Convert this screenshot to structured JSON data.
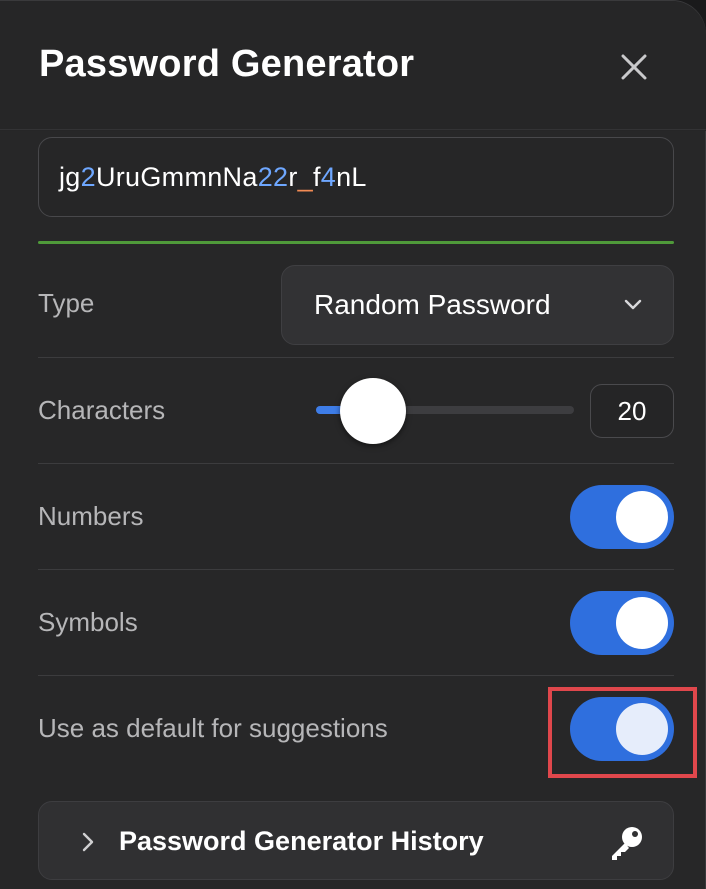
{
  "header": {
    "title": "Password Generator",
    "close_icon": "close-icon"
  },
  "password": {
    "segments": [
      {
        "text": "jg",
        "kind": "letter"
      },
      {
        "text": "2",
        "kind": "digit"
      },
      {
        "text": "UruGmmnNa",
        "kind": "letter"
      },
      {
        "text": "22",
        "kind": "digit"
      },
      {
        "text": "r",
        "kind": "letter"
      },
      {
        "text": "_",
        "kind": "symbol"
      },
      {
        "text": "f",
        "kind": "letter"
      },
      {
        "text": "4",
        "kind": "digit"
      },
      {
        "text": "nL",
        "kind": "letter"
      }
    ],
    "strength_color": "#4f9a3a"
  },
  "type_row": {
    "label": "Type",
    "selected": "Random Password",
    "icon": "chevron-down-icon"
  },
  "characters_row": {
    "label": "Characters",
    "value": "20",
    "slider_fraction": 0.2
  },
  "numbers_row": {
    "label": "Numbers",
    "enabled": true
  },
  "symbols_row": {
    "label": "Symbols",
    "enabled": true
  },
  "default_row": {
    "label": "Use as default for suggestions",
    "enabled": true
  },
  "history": {
    "label": "Password Generator History",
    "arrow_icon": "chevron-right-icon",
    "key_icon": "key-icon"
  },
  "colors": {
    "accent": "#2f6fde",
    "digit": "#6ea7ff",
    "symbol": "#f28b54",
    "highlight": "#e0474c"
  }
}
